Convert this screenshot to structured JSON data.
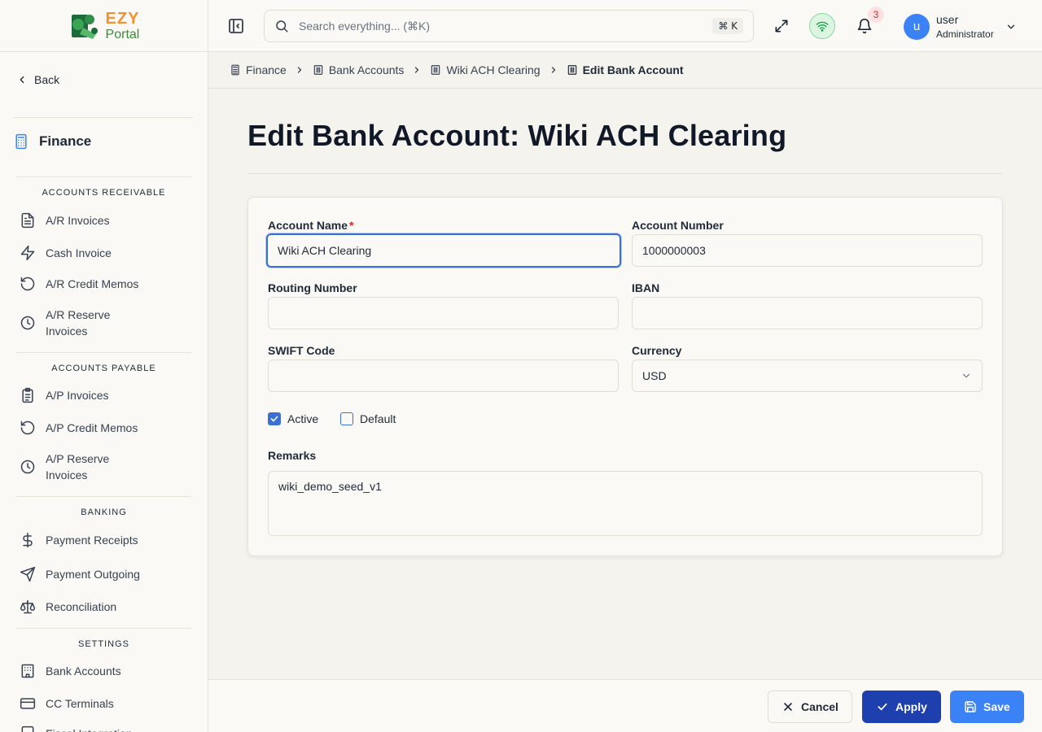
{
  "app": {
    "logo_ezy": "EZY",
    "logo_portal": "Portal"
  },
  "sidebar": {
    "back_label": "Back",
    "module_title": "Finance",
    "sections": {
      "ar": "ACCOUNTS RECEIVABLE",
      "ap": "ACCOUNTS PAYABLE",
      "banking": "BANKING",
      "settings": "SETTINGS"
    },
    "items": {
      "ar_invoices": "A/R Invoices",
      "cash_invoice": "Cash Invoice",
      "ar_credit_memos": "A/R Credit Memos",
      "ar_reserve_invoices": "A/R Reserve Invoices",
      "ap_invoices": "A/P Invoices",
      "ap_credit_memos": "A/P Credit Memos",
      "ap_reserve_invoices": "A/P Reserve Invoices",
      "payment_receipts": "Payment Receipts",
      "payment_outgoing": "Payment Outgoing",
      "reconciliation": "Reconciliation",
      "bank_accounts": "Bank Accounts",
      "cc_terminals": "CC Terminals",
      "fiscal_integration": "Fiscal Integration"
    }
  },
  "topbar": {
    "search_placeholder": "Search everything... (⌘K)",
    "search_shortcut": "⌘ K",
    "notification_count": "3",
    "user_initial": "u",
    "user_name": "user",
    "user_role": "Administrator"
  },
  "breadcrumb": {
    "items": [
      "Finance",
      "Bank Accounts",
      "Wiki ACH Clearing",
      "Edit Bank Account"
    ]
  },
  "page": {
    "title": "Edit Bank Account: Wiki ACH Clearing"
  },
  "form": {
    "account_name_label": "Account Name",
    "account_name_required": "*",
    "account_name_value": "Wiki ACH Clearing",
    "account_number_label": "Account Number",
    "account_number_value": "1000000003",
    "routing_number_label": "Routing Number",
    "routing_number_value": "",
    "iban_label": "IBAN",
    "iban_value": "",
    "swift_code_label": "SWIFT Code",
    "swift_code_value": "",
    "currency_label": "Currency",
    "currency_value": "USD",
    "active_label": "Active",
    "active_checked": true,
    "default_label": "Default",
    "default_checked": false,
    "remarks_label": "Remarks",
    "remarks_value": "wiki_demo_seed_v1"
  },
  "footer": {
    "cancel_label": "Cancel",
    "apply_label": "Apply",
    "save_label": "Save"
  },
  "colors": {
    "primary": "#3b82f6",
    "apply": "#1e40af",
    "brand_orange": "#f39233",
    "brand_green": "#3a8a3a"
  }
}
